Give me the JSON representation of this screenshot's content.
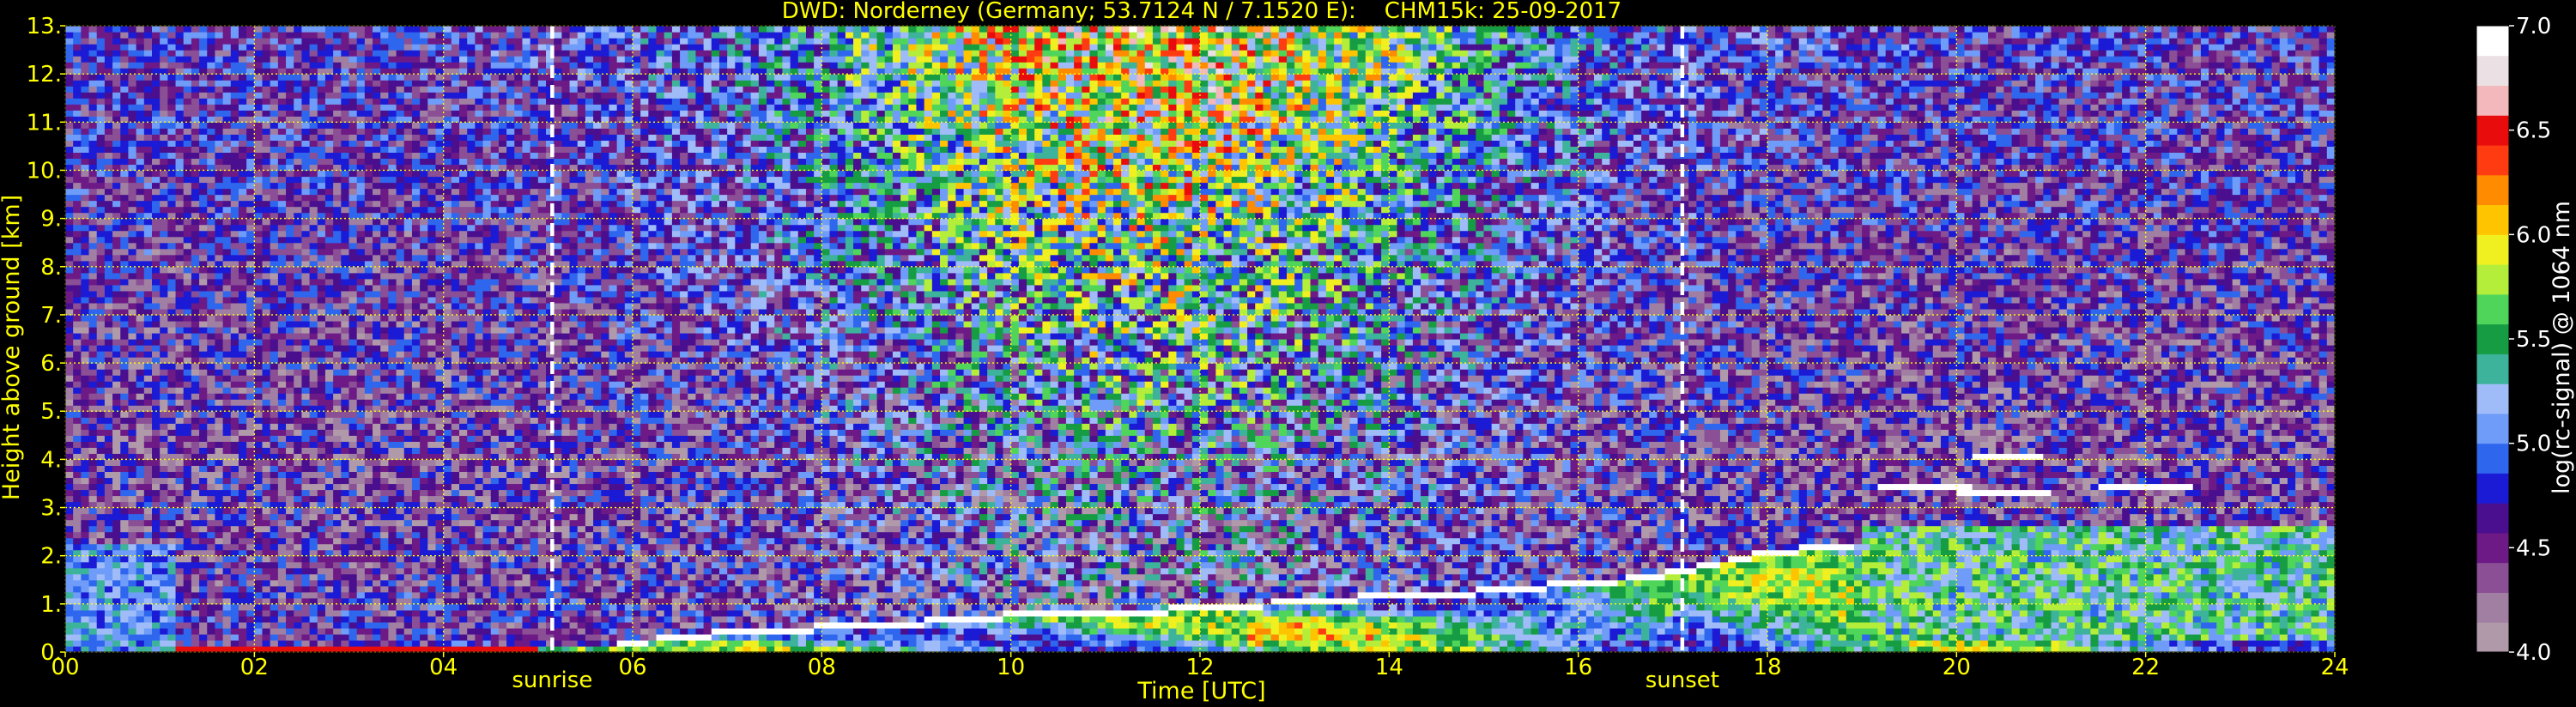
{
  "chart_data": {
    "type": "heatmap",
    "title": "DWD: Norderney (Germany; 53.7124 N / 7.1520 E):    CHM15k: 25-09-2017",
    "xlabel": "Time [UTC]",
    "ylabel": "Height above ground [km]",
    "colorbar_label": "log(rc-signal) @ 1064 nm",
    "xlim": [
      0,
      24
    ],
    "ylim": [
      0,
      13
    ],
    "clim": [
      4.0,
      7.0
    ],
    "x_ticks": [
      0,
      2,
      4,
      6,
      8,
      10,
      12,
      14,
      16,
      18,
      20,
      22,
      24
    ],
    "x_tick_labels": [
      "00",
      "02",
      "04",
      "06",
      "08",
      "10",
      "12",
      "14",
      "16",
      "18",
      "20",
      "22",
      "24"
    ],
    "y_ticks": [
      0,
      1,
      2,
      3,
      4,
      5,
      6,
      7,
      8,
      9,
      10,
      11,
      12,
      13
    ],
    "y_tick_labels": [
      "0.",
      "1.",
      "2.",
      "3.",
      "4.",
      "5.",
      "6.",
      "7.",
      "8.",
      "9.",
      "10.",
      "11.",
      "12.",
      "13."
    ],
    "colorbar_ticks": [
      4.0,
      4.5,
      5.0,
      5.5,
      6.0,
      6.5,
      7.0
    ],
    "colorbar_tick_labels": [
      "4.0",
      "4.5",
      "5.0",
      "5.5",
      "6.0",
      "6.5",
      "7.0"
    ],
    "grid": true,
    "markers": [
      {
        "label": "sunrise",
        "time": 5.15
      },
      {
        "label": "sunset",
        "time": 17.1
      }
    ],
    "boundary_layer_top": [
      [
        0,
        0.15
      ],
      [
        2,
        0.12
      ],
      [
        4,
        0.1
      ],
      [
        5,
        0.1
      ],
      [
        6,
        0.15
      ],
      [
        7,
        0.35
      ],
      [
        8,
        0.45
      ],
      [
        9,
        0.55
      ],
      [
        10,
        0.7
      ],
      [
        11,
        0.75
      ],
      [
        12,
        0.85
      ],
      [
        12.5,
        0.9
      ],
      [
        13,
        1.0
      ],
      [
        14,
        1.1
      ],
      [
        15,
        1.2
      ],
      [
        15.5,
        1.3
      ],
      [
        16,
        1.35
      ],
      [
        16.5,
        1.45
      ],
      [
        17,
        1.6
      ],
      [
        17.5,
        1.8
      ],
      [
        18,
        2.0
      ],
      [
        18.5,
        2.1
      ],
      [
        19,
        2.2
      ]
    ],
    "cloud_layers": [
      {
        "start": 20.2,
        "end": 20.9,
        "height": 4.1
      },
      {
        "start": 19.2,
        "end": 20.2,
        "height": 3.4
      },
      {
        "start": 20.0,
        "end": 21.0,
        "height": 3.35
      },
      {
        "start": 21.5,
        "end": 22.5,
        "height": 3.45
      }
    ],
    "colormap": [
      "#b09aaa",
      "#a07fa3",
      "#8a4f95",
      "#6e1a86",
      "#4a0f8f",
      "#1b1bd6",
      "#2f66ee",
      "#6f9cf8",
      "#9fbcf8",
      "#3cb39a",
      "#169c43",
      "#4fd55a",
      "#b4ee3a",
      "#f0f020",
      "#ffc400",
      "#ff8c00",
      "#ff3b12",
      "#e80c0c",
      "#f2b8bb",
      "#ebe0e3",
      "#ffffff"
    ]
  }
}
